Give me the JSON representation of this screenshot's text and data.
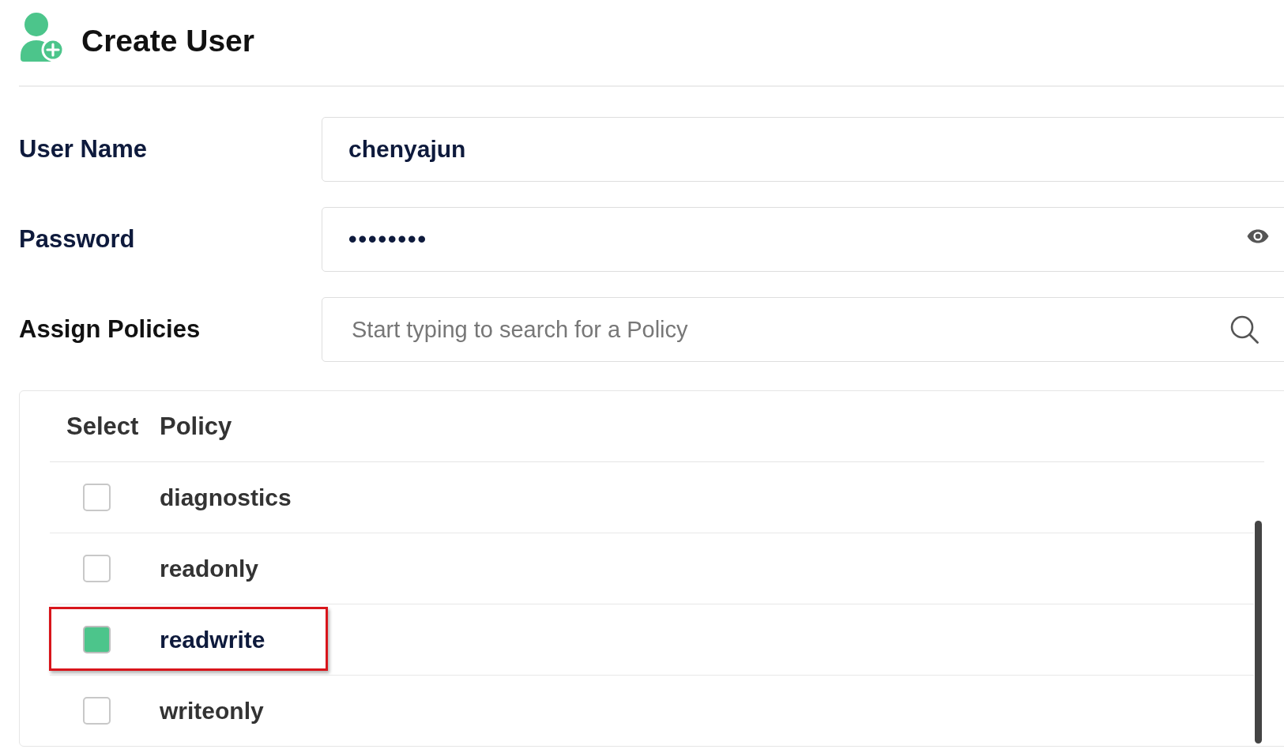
{
  "header": {
    "title": "Create User"
  },
  "form": {
    "fields": [
      {
        "kind": "text",
        "label": "User Name",
        "value": "chenyajun"
      },
      {
        "kind": "password",
        "label": "Password",
        "value": "••••••••"
      },
      {
        "kind": "search",
        "label": "Assign Policies",
        "placeholder": "Start typing to search for a Policy"
      }
    ]
  },
  "policies_table": {
    "columns": [
      "Select",
      "Policy"
    ],
    "rows": [
      {
        "name": "diagnostics",
        "checked": false,
        "highlighted": false
      },
      {
        "name": "readonly",
        "checked": false,
        "highlighted": false
      },
      {
        "name": "readwrite",
        "checked": true,
        "highlighted": true
      },
      {
        "name": "writeonly",
        "checked": false,
        "highlighted": false
      }
    ]
  }
}
